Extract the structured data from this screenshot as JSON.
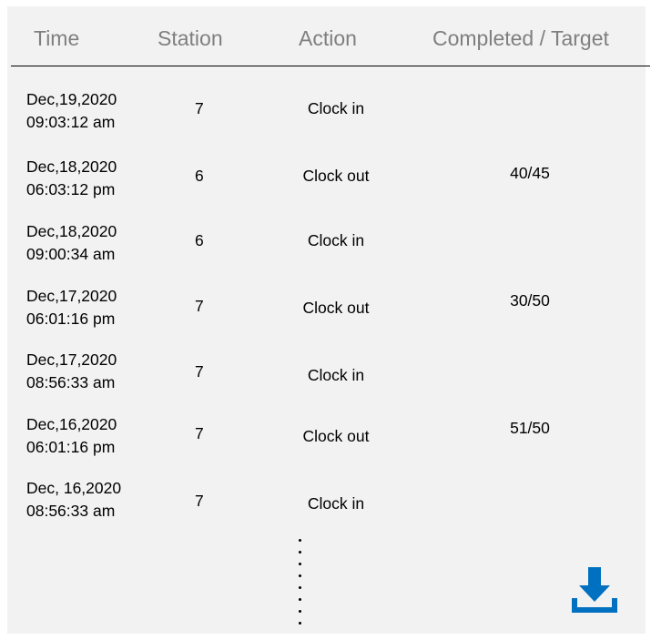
{
  "header": {
    "time": "Time",
    "station": "Station",
    "action": "Action",
    "completed_target": "Completed / Target"
  },
  "rows": [
    {
      "date": "Dec,19,2020",
      "clock": "09:03:12 am",
      "station": "7",
      "action": "Clock in",
      "completed": ""
    },
    {
      "date": "Dec,18,2020",
      "clock": "06:03:12 pm",
      "station": "6",
      "action": "Clock out",
      "completed": "40/45"
    },
    {
      "date": "Dec,18,2020",
      "clock": "09:00:34 am",
      "station": "6",
      "action": "Clock in",
      "completed": ""
    },
    {
      "date": "Dec,17,2020",
      "clock": "06:01:16 pm",
      "station": "7",
      "action": "Clock out",
      "completed": "30/50"
    },
    {
      "date": "Dec,17,2020",
      "clock": "08:56:33 am",
      "station": "7",
      "action": "Clock in",
      "completed": ""
    },
    {
      "date": "Dec,16,2020",
      "clock": "06:01:16 pm",
      "station": "7",
      "action": "Clock out",
      "completed": "51/50"
    },
    {
      "date": "Dec, 16,2020",
      "clock": "08:56:33 am",
      "station": "7",
      "action": "Clock in",
      "completed": ""
    }
  ],
  "icons": {
    "download": "download-icon",
    "more": "vertical-ellipsis"
  },
  "colors": {
    "panel_bg": "#f2f2f2",
    "header_text": "#7f7f7f",
    "download_icon": "#0070c0"
  }
}
